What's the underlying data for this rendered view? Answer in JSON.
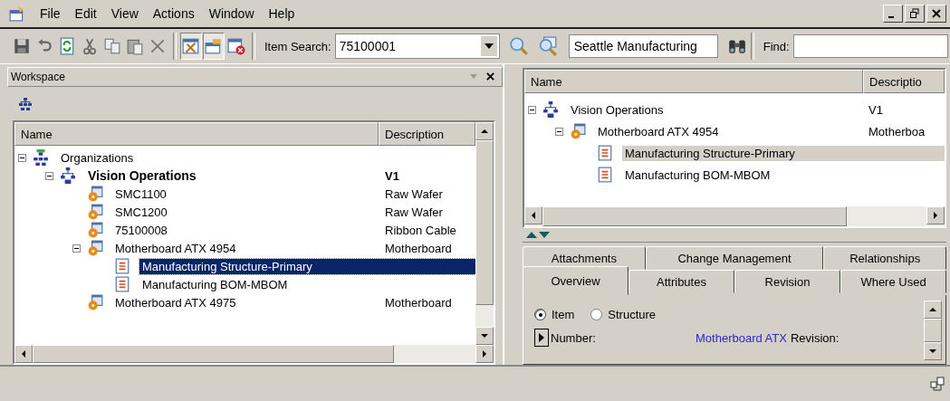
{
  "menu": [
    {
      "label": "File"
    },
    {
      "label": "Edit"
    },
    {
      "label": "View"
    },
    {
      "label": "Actions"
    },
    {
      "label": "Window"
    },
    {
      "label": "Help"
    }
  ],
  "toolbar": {
    "buttons": [
      {
        "kind": "save",
        "pressed": false
      },
      {
        "kind": "undo",
        "pressed": false
      },
      {
        "kind": "refresh",
        "pressed": false
      },
      {
        "kind": "cut",
        "pressed": false
      },
      {
        "kind": "copy",
        "pressed": false
      },
      {
        "kind": "paste",
        "pressed": false
      },
      {
        "kind": "delete",
        "pressed": false
      },
      {
        "kind": "tools",
        "pressed": true
      },
      {
        "kind": "folder",
        "pressed": true
      },
      {
        "kind": "close-doc",
        "pressed": false
      }
    ],
    "item_search": {
      "label": "Item Search:",
      "value": "75100001"
    },
    "location": {
      "value": "Seattle Manufacturing"
    },
    "find": {
      "label": "Find:"
    }
  },
  "workspace": {
    "title": "Workspace",
    "columns": [
      "Name",
      "Description"
    ],
    "tree": [
      {
        "kind": "organizations",
        "name": "Organizations",
        "expanded": true,
        "selected": false,
        "children": [
          {
            "kind": "organization",
            "name": "Vision Operations",
            "description": "V1",
            "bold": true,
            "expanded": true,
            "selected": false,
            "children": [
              {
                "kind": "item",
                "name": "SMC1100",
                "description": "Raw Wafer",
                "selected": false
              },
              {
                "kind": "item",
                "name": "SMC1200",
                "description": "Raw Wafer",
                "selected": false
              },
              {
                "kind": "item",
                "name": "75100008",
                "description": "Ribbon Cable",
                "selected": false
              },
              {
                "kind": "item",
                "name": "Motherboard ATX 4954",
                "description": "Motherboard",
                "expanded": true,
                "selected": false,
                "children": [
                  {
                    "kind": "structure",
                    "name": "Manufacturing Structure-Primary",
                    "selected": true
                  },
                  {
                    "kind": "structure",
                    "name": "Manufacturing BOM-MBOM",
                    "selected": false
                  }
                ]
              },
              {
                "kind": "item",
                "name": "Motherboard ATX 4975",
                "description": "Motherboard",
                "selected": false
              }
            ]
          }
        ]
      }
    ]
  },
  "details": {
    "columns": [
      "Name",
      "Descriptio"
    ],
    "tree": [
      {
        "kind": "organization",
        "name": "Vision Operations",
        "description": "V1",
        "bold": false,
        "expanded": true,
        "selected": false,
        "children": [
          {
            "kind": "item",
            "name": "Motherboard ATX 4954",
            "description": "Motherboa",
            "expanded": true,
            "selected": false,
            "children": [
              {
                "kind": "structure",
                "name": "Manufacturing Structure-Primary",
                "selected": true
              },
              {
                "kind": "structure",
                "name": "Manufacturing BOM-MBOM",
                "selected": false
              }
            ]
          }
        ]
      }
    ],
    "tab_rows": [
      {
        "tabs": [
          {
            "label": "Attachments",
            "selected": false
          },
          {
            "label": "Change Management",
            "selected": false
          },
          {
            "label": "Relationships",
            "selected": false
          }
        ]
      },
      {
        "tabs": [
          {
            "label": "Overview",
            "selected": true
          },
          {
            "label": "Attributes",
            "selected": false
          },
          {
            "label": "Revision",
            "selected": false
          },
          {
            "label": "Where Used",
            "selected": false
          }
        ]
      }
    ],
    "radios": [
      {
        "label": "Item",
        "selected": true
      },
      {
        "label": "Structure",
        "selected": false
      }
    ],
    "number": {
      "label": "Number:",
      "value": "Motherboard ATX",
      "next_label": "Revision:"
    }
  }
}
